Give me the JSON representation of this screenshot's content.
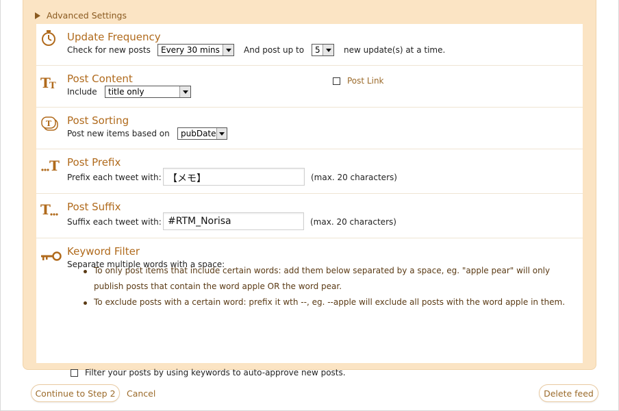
{
  "advanced_settings": {
    "label": "Advanced Settings"
  },
  "update_frequency": {
    "title": "Update Frequency",
    "check_label": "Check for new posts",
    "interval_value": "Every 30 mins",
    "post_up_to_label": "And post up to",
    "count_value": "5",
    "suffix_label": "new update(s) at a time."
  },
  "post_content": {
    "title": "Post Content",
    "include_label": "Include",
    "include_value": "title only",
    "post_link_label": "Post Link"
  },
  "post_sorting": {
    "title": "Post Sorting",
    "label": "Post new items based on",
    "value": "pubDate"
  },
  "post_prefix": {
    "title": "Post Prefix",
    "label": "Prefix each tweet with:",
    "value": "【メモ】",
    "hint": "(max. 20 characters)"
  },
  "post_suffix": {
    "title": "Post Suffix",
    "label": "Suffix each tweet with:",
    "value": "#RTM_Norisa",
    "hint": "(max. 20 characters)"
  },
  "keyword_filter": {
    "title": "Keyword Filter",
    "description": "Separate multiple words with a space:",
    "bullets": [
      "To only post items that include certain words: add them below separated by a space, eg. \"apple pear\" will only publish posts that contain the word apple OR the word pear.",
      "To exclude posts with a certain word: prefix it wth --, eg. --apple will exclude all posts with the word apple in them."
    ],
    "filter_checkbox_label": "Filter your posts by using keywords to auto-approve new posts."
  },
  "footer": {
    "continue_label": "Continue to Step 2",
    "cancel_label": "Cancel",
    "delete_label": "Delete feed"
  },
  "colors": {
    "panel_bg": "#fbe4c4",
    "title_color": "#b06a1c",
    "accent_brown": "#9b6a2a"
  }
}
